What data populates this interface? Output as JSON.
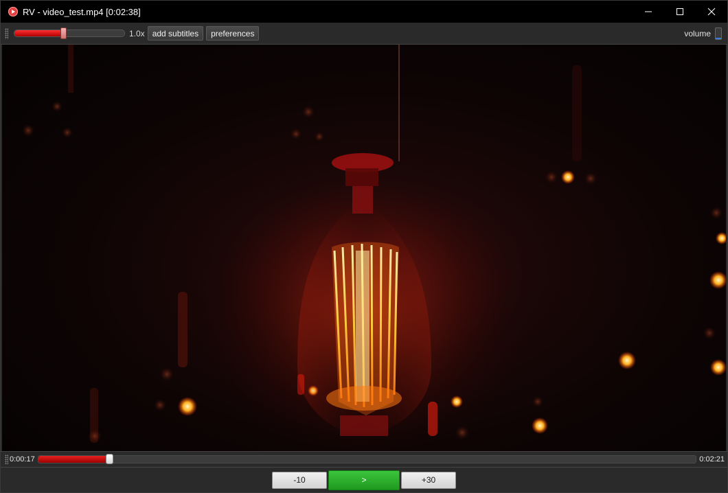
{
  "window": {
    "title": "RV - video_test.mp4 [0:02:38]"
  },
  "toolbar": {
    "speed_value": "1.0x",
    "speed_level": 0.44,
    "add_subtitles_label": "add subtitles",
    "preferences_label": "preferences",
    "volume_label": "volume",
    "volume_level": 0.1
  },
  "playback": {
    "current_time": "0:00:17",
    "remaining_time": "0:02:21",
    "progress_fraction": 0.1076,
    "back_label": "-10",
    "play_label": ">",
    "forward_label": "+30"
  },
  "colors": {
    "accent_red": "#e82020",
    "play_green": "#2fb52f",
    "titlebar_bg": "#000000",
    "toolbar_bg": "#2a2a2a"
  },
  "icons": {
    "app": "rv-app-icon",
    "minimize": "minimize-icon",
    "maximize": "maximize-icon",
    "close": "close-icon"
  }
}
